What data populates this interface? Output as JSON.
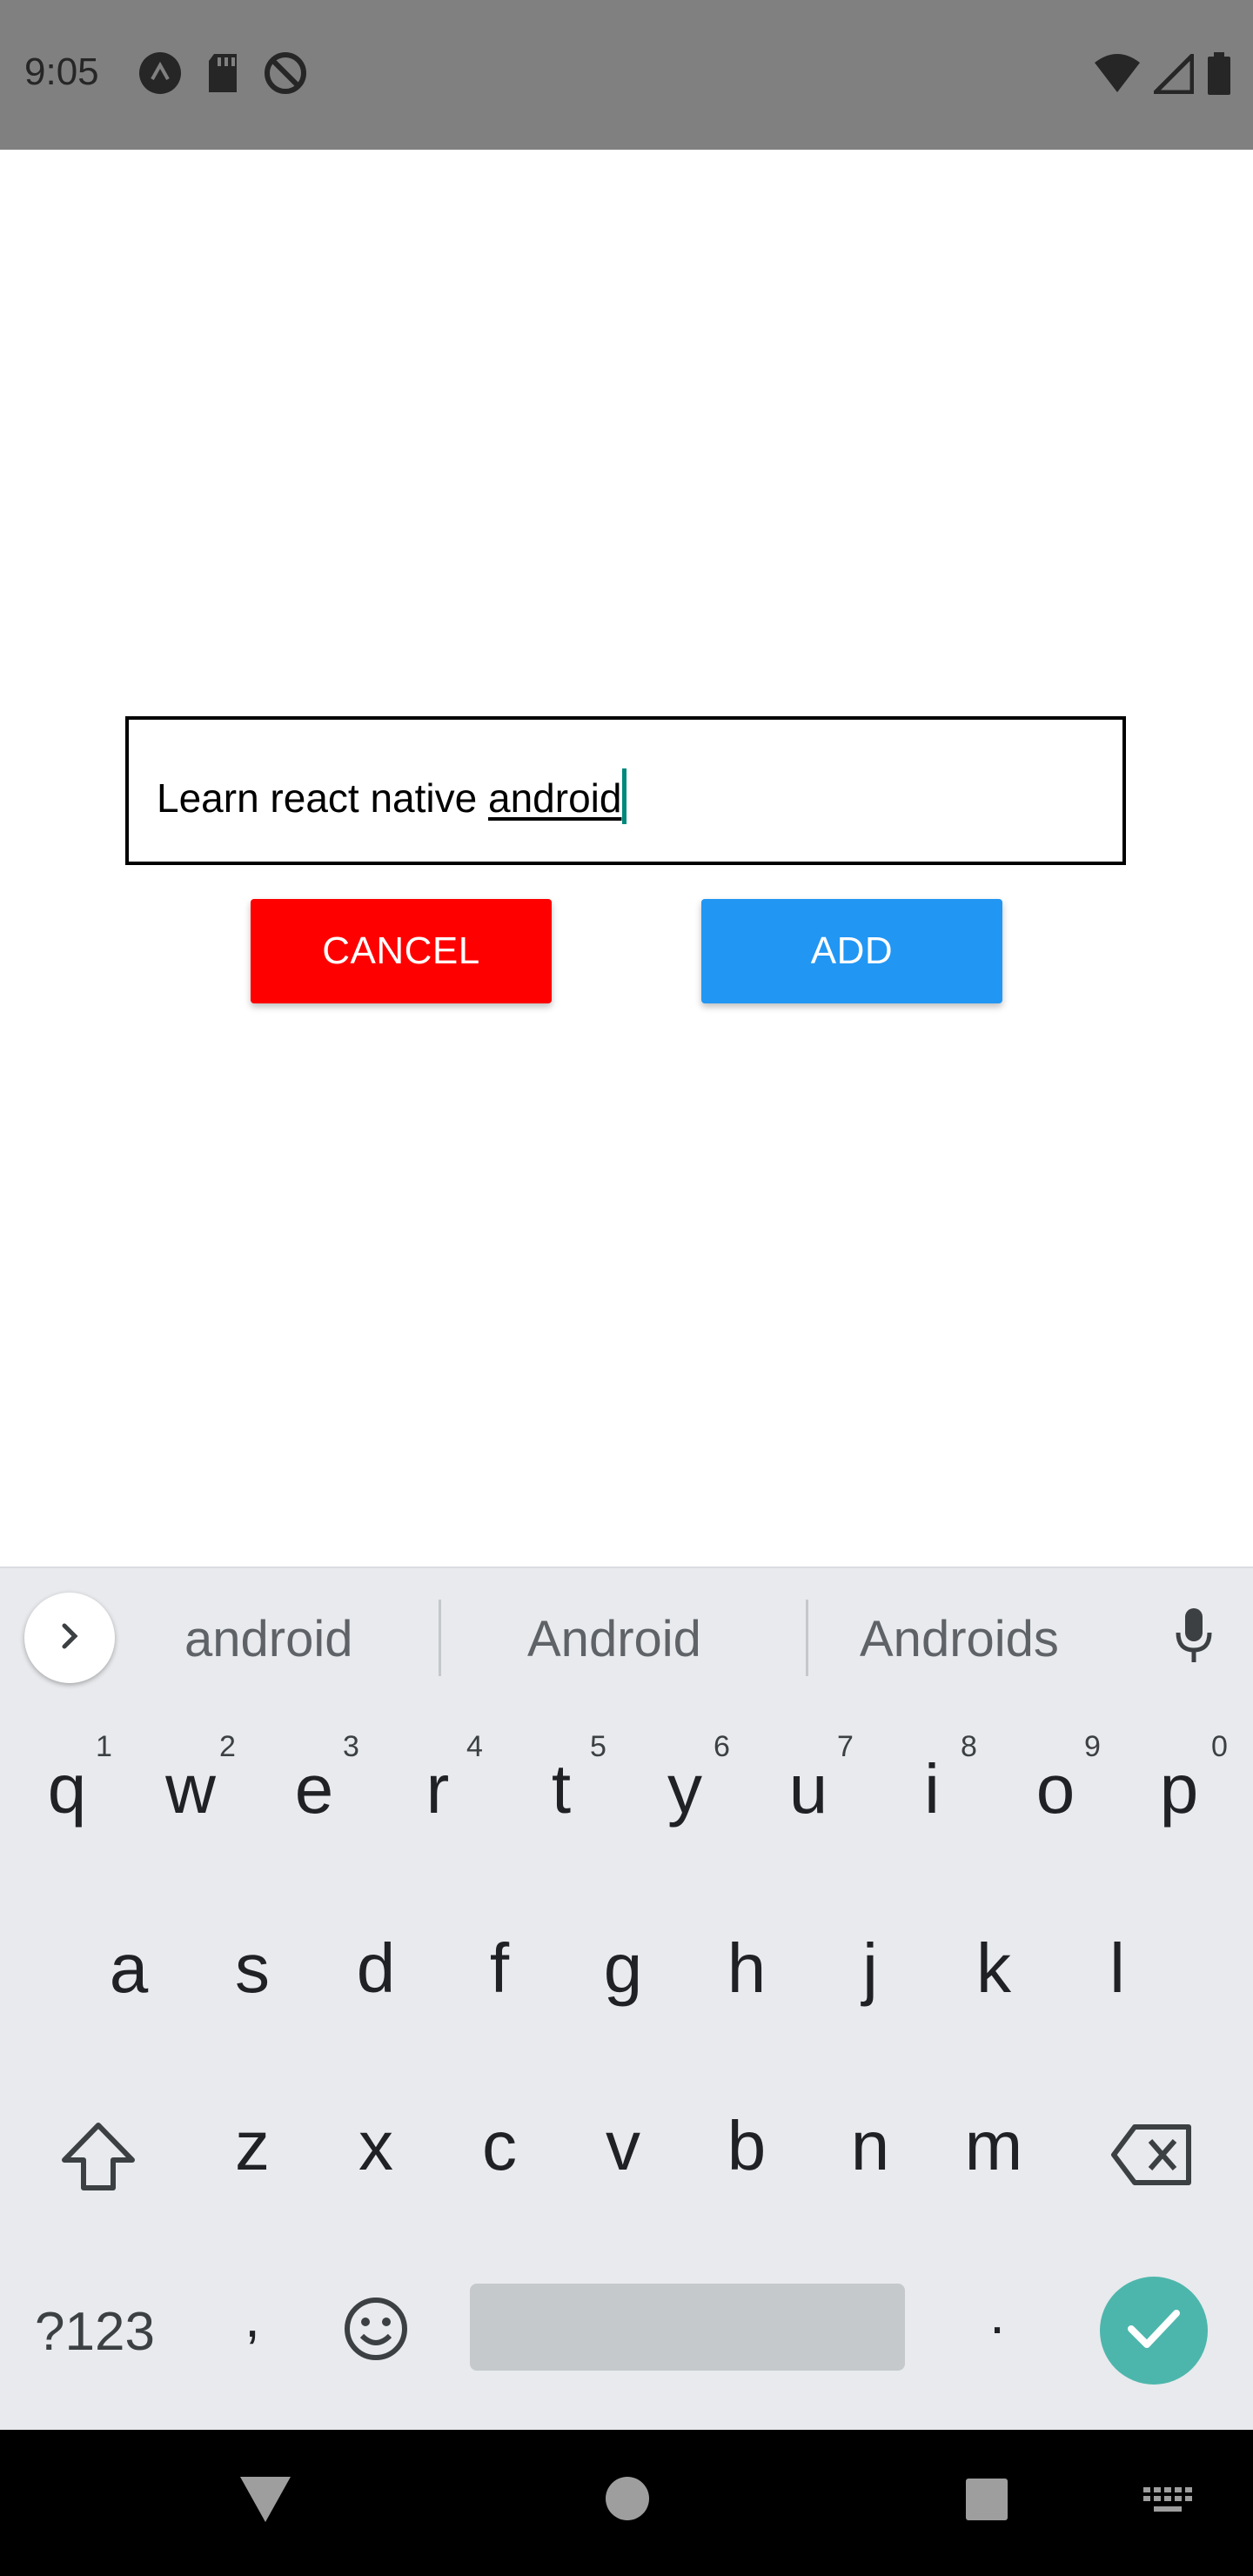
{
  "status_bar": {
    "time": "9:05",
    "left_icons": [
      "a-circle-icon",
      "sd-card-icon",
      "do-not-disturb-icon"
    ],
    "right_icons": [
      "wifi-icon",
      "cell-signal-icon",
      "battery-icon"
    ],
    "background": "#808080"
  },
  "form": {
    "input_value_plain": "Learn react native ",
    "input_value_composing": "android",
    "cancel_label": "CANCEL",
    "add_label": "ADD",
    "cancel_color": "#ff0000",
    "add_color": "#2196f3"
  },
  "keyboard": {
    "suggestions": [
      "android",
      "Android",
      "Androids"
    ],
    "row1": [
      "q",
      "w",
      "e",
      "r",
      "t",
      "y",
      "u",
      "i",
      "o",
      "p"
    ],
    "row1_hints": [
      "1",
      "2",
      "3",
      "4",
      "5",
      "6",
      "7",
      "8",
      "9",
      "0"
    ],
    "row2": [
      "a",
      "s",
      "d",
      "f",
      "g",
      "h",
      "j",
      "k",
      "l"
    ],
    "row3": [
      "z",
      "x",
      "c",
      "v",
      "b",
      "n",
      "m"
    ],
    "symbols_label": "?123",
    "comma": ",",
    "period": ".",
    "enter_color": "#4db6ac"
  },
  "nav_bar": {
    "icons": [
      "back-icon",
      "home-icon",
      "recents-icon",
      "keyboard-switch-icon"
    ]
  }
}
